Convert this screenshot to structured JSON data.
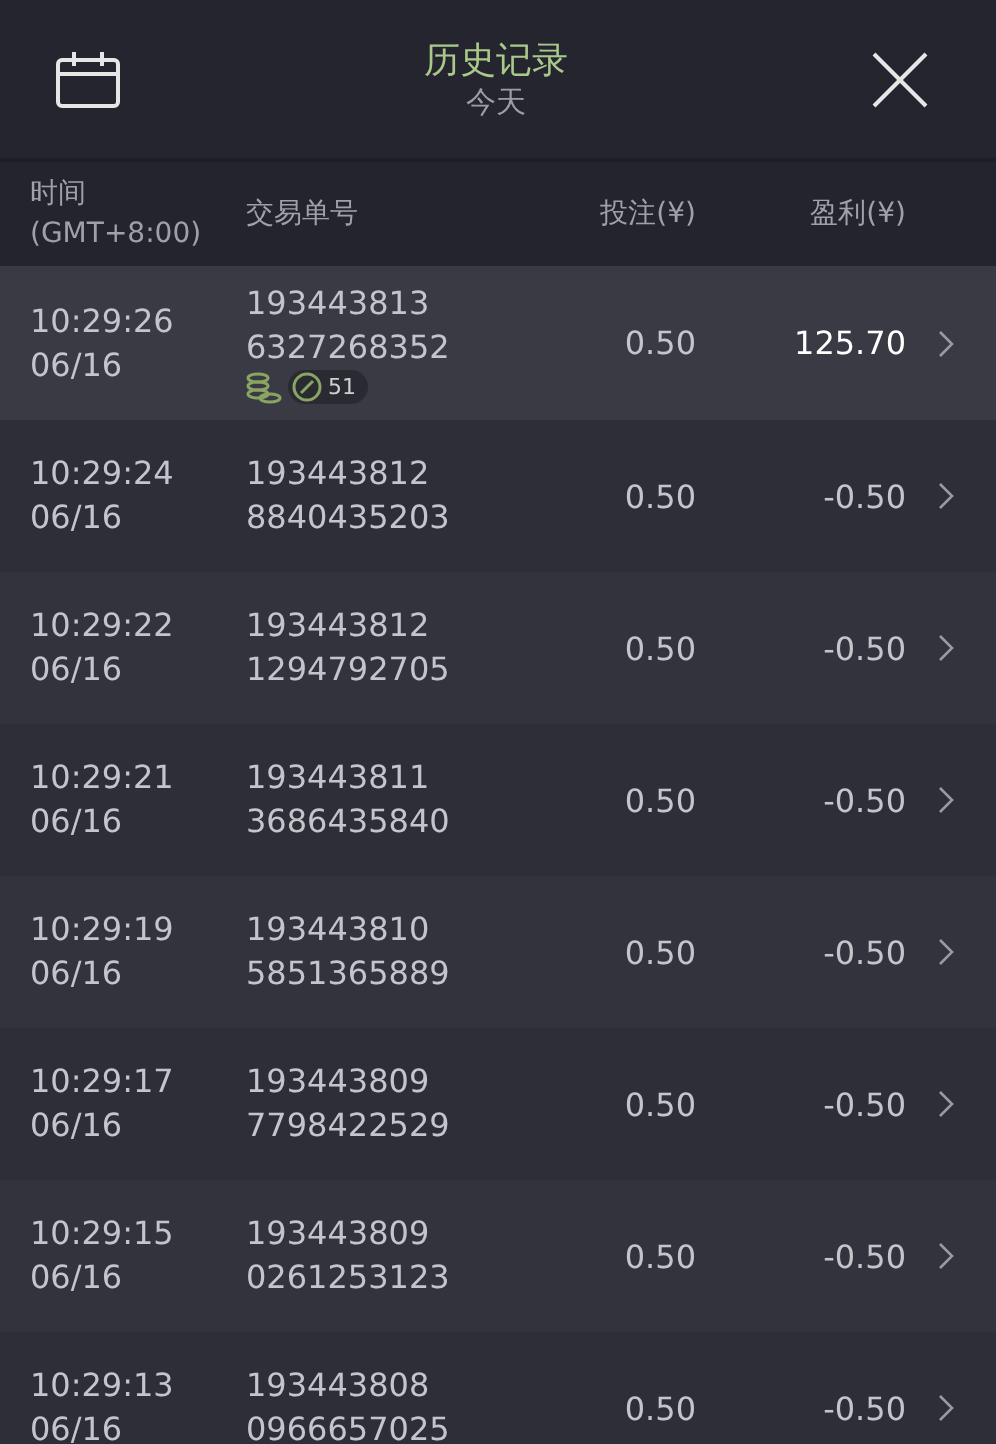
{
  "header": {
    "title": "历史记录",
    "subtitle": "今天"
  },
  "columns": [
    {
      "line1": "时间",
      "line2": "(GMT+8:00)"
    },
    {
      "line1": "交易单号"
    },
    {
      "line1": "投注(¥)"
    },
    {
      "line1": "盈利(¥)"
    }
  ],
  "rows": [
    {
      "time": "10:29:26",
      "date": "06/16",
      "id1": "193443813",
      "id2": "6327268352",
      "stake": "0.50",
      "profit": "125.70",
      "selected": true,
      "win": true,
      "badge_count": "51"
    },
    {
      "time": "10:29:24",
      "date": "06/16",
      "id1": "193443812",
      "id2": "8840435203",
      "stake": "0.50",
      "profit": "-0.50",
      "selected": false,
      "win": false
    },
    {
      "time": "10:29:22",
      "date": "06/16",
      "id1": "193443812",
      "id2": "1294792705",
      "stake": "0.50",
      "profit": "-0.50",
      "selected": false,
      "win": false
    },
    {
      "time": "10:29:21",
      "date": "06/16",
      "id1": "193443811",
      "id2": "3686435840",
      "stake": "0.50",
      "profit": "-0.50",
      "selected": false,
      "win": false
    },
    {
      "time": "10:29:19",
      "date": "06/16",
      "id1": "193443810",
      "id2": "5851365889",
      "stake": "0.50",
      "profit": "-0.50",
      "selected": false,
      "win": false
    },
    {
      "time": "10:29:17",
      "date": "06/16",
      "id1": "193443809",
      "id2": "7798422529",
      "stake": "0.50",
      "profit": "-0.50",
      "selected": false,
      "win": false
    },
    {
      "time": "10:29:15",
      "date": "06/16",
      "id1": "193443809",
      "id2": "0261253123",
      "stake": "0.50",
      "profit": "-0.50",
      "selected": false,
      "win": false
    },
    {
      "time": "10:29:13",
      "date": "06/16",
      "id1": "193443808",
      "id2": "0966657025",
      "stake": "0.50",
      "profit": "-0.50",
      "selected": false,
      "win": false
    }
  ]
}
